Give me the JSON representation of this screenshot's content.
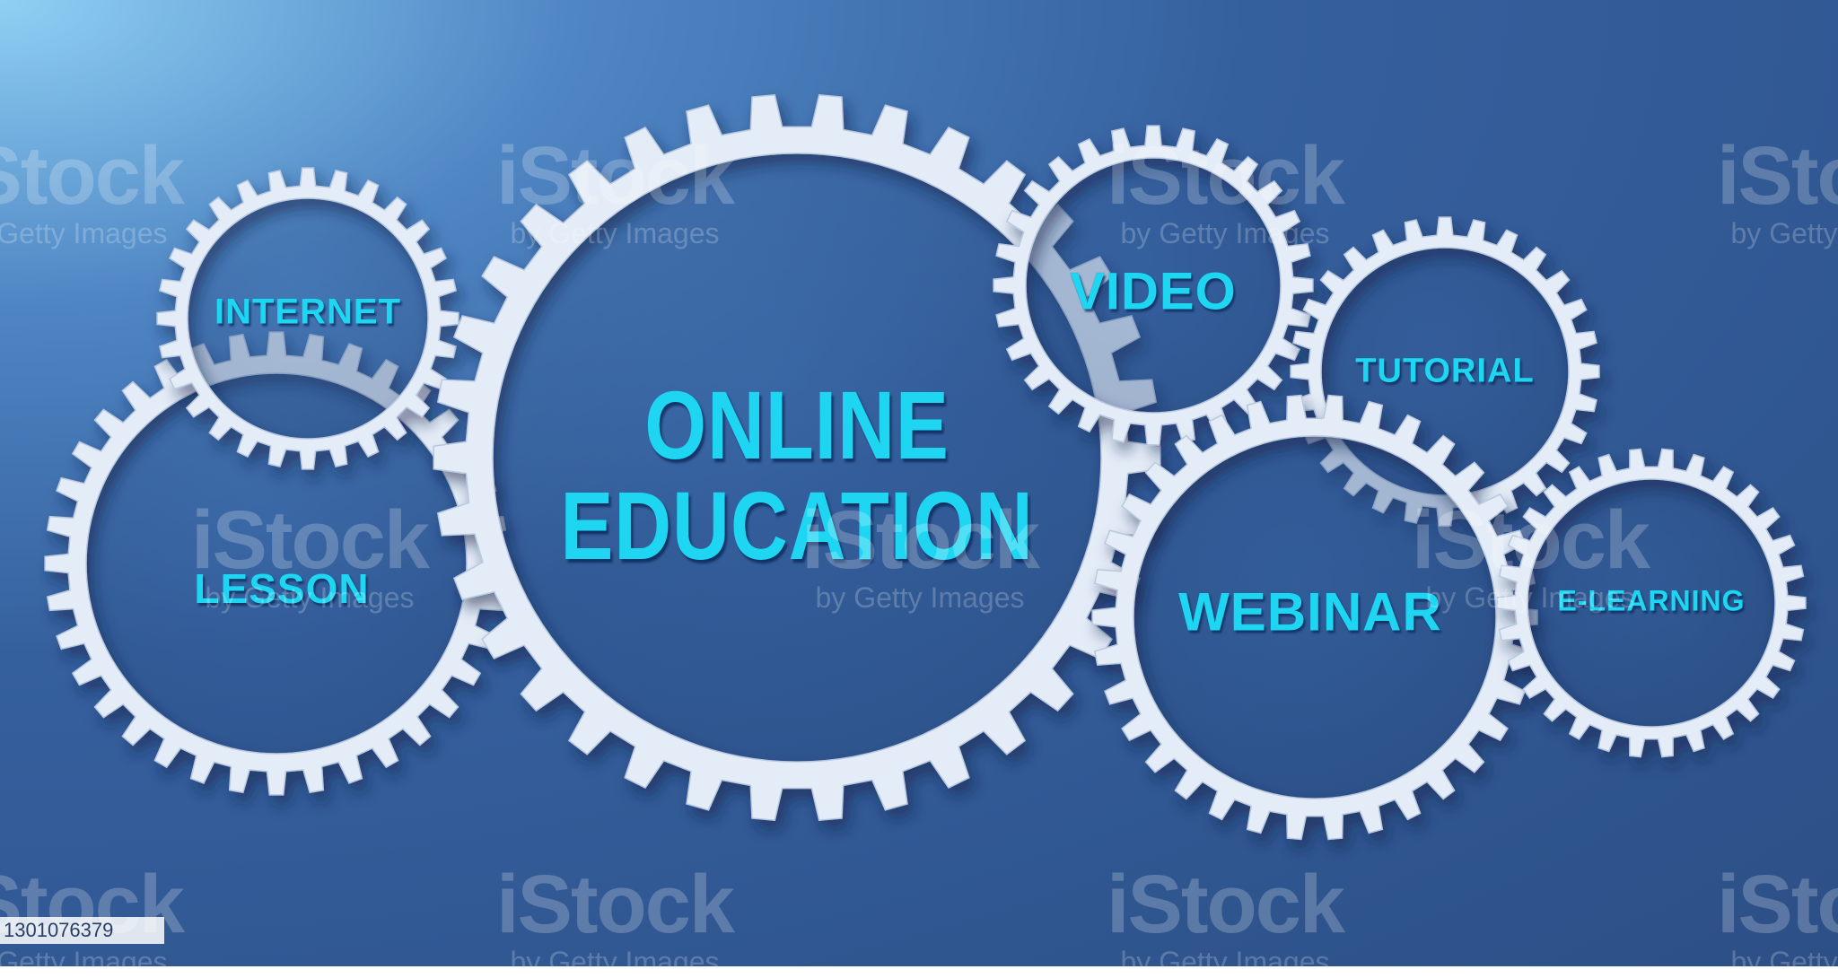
{
  "scene": {
    "main_title_line1": "ONLINE",
    "main_title_line2": "EDUCATION",
    "labels": {
      "internet": "INTERNET",
      "lesson": "LESSON",
      "video": "VIDEO",
      "tutorial": "TUTORIAL",
      "webinar": "WEBINAR",
      "elearning": "E-LEARNING"
    }
  },
  "watermark": {
    "brand": "iStock",
    "sub": "by Getty Images"
  },
  "stock_id": "1301076379",
  "colors": {
    "label_cyan": "#1fd6f2",
    "gear_white": "#e3ecf7",
    "background_blue": "#2c4f86"
  }
}
